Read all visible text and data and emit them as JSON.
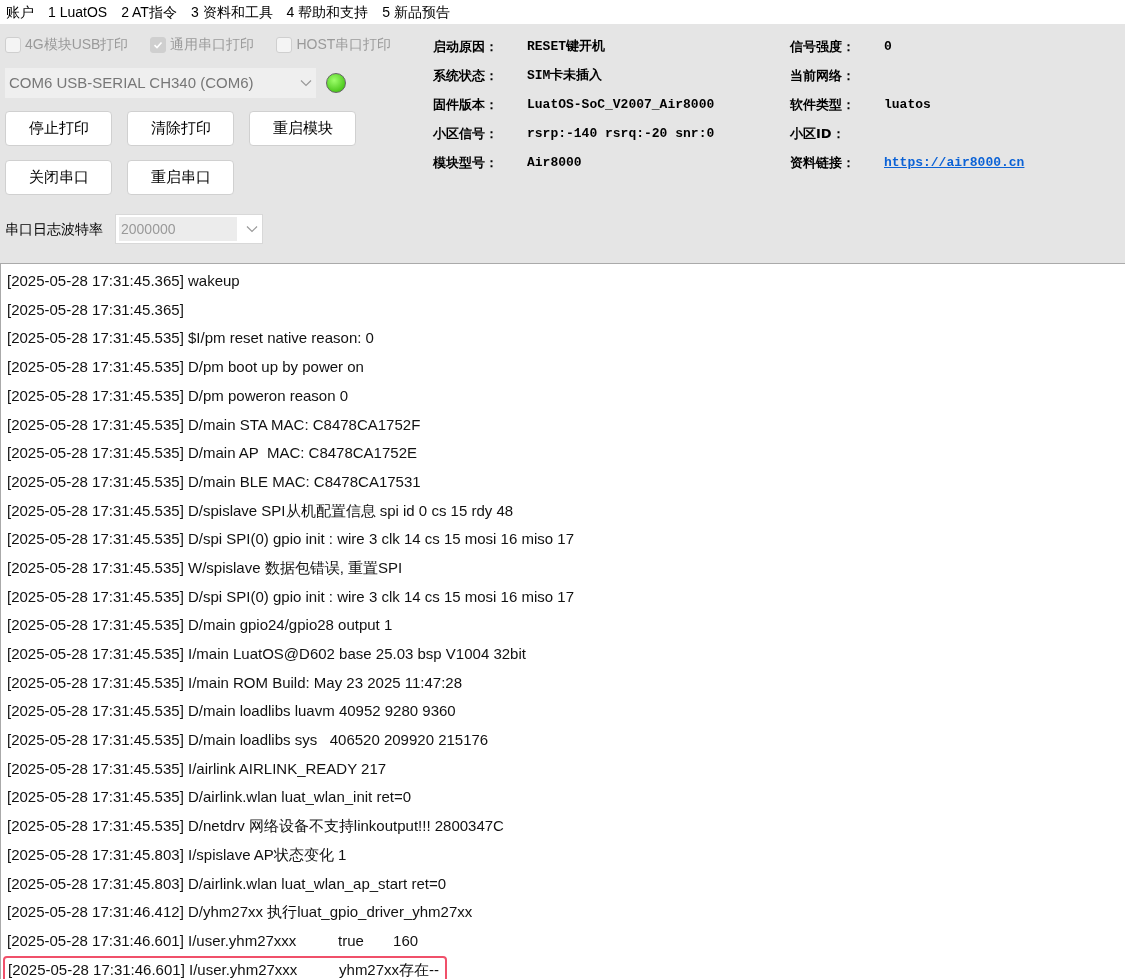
{
  "menu": [
    "账户",
    "1 LuatOS",
    "2 AT指令",
    "3 资料和工具",
    "4 帮助和支持",
    "5 新品预告"
  ],
  "print_options": [
    {
      "label": "4G模块USB打印",
      "checked": false,
      "disabled": true
    },
    {
      "label": "通用串口打印",
      "checked": true,
      "disabled": true
    },
    {
      "label": "HOST串口打印",
      "checked": false,
      "disabled": true
    }
  ],
  "port_select": {
    "value": "COM6 USB-SERIAL CH340 (COM6)",
    "connected": true,
    "disabled": true
  },
  "buttons": [
    [
      "停止打印",
      "清除打印",
      "重启模块"
    ],
    [
      "关闭串口",
      "重启串口"
    ]
  ],
  "baud": {
    "label": "串口日志波特率",
    "value": "2000000",
    "disabled": true
  },
  "info": [
    {
      "label": "启动原因：",
      "value": "RESET键开机"
    },
    {
      "label": "信号强度：",
      "value": "0"
    },
    {
      "label": "系统状态：",
      "value": "SIM卡未插入"
    },
    {
      "label": "当前网络："
    },
    {
      "label": "固件版本：",
      "value": "LuatOS-SoC_V2007_Air8000"
    },
    {
      "label": "软件类型：",
      "value": "luatos"
    },
    {
      "label": "小区信号：",
      "value": "rsrp:-140 rsrq:-20 snr:0"
    },
    {
      "label": "小区ID："
    },
    {
      "label": "模块型号：",
      "value": "Air8000"
    },
    {
      "label": "资料链接：",
      "value": "https://air8000.cn",
      "kind": "link"
    }
  ],
  "log": [
    {
      "text": "[2025-05-28 17:31:45.365] wakeup",
      "highlighted": false
    },
    {
      "text": "[2025-05-28 17:31:45.365]",
      "highlighted": false
    },
    {
      "text": "[2025-05-28 17:31:45.535] $I/pm reset native reason: 0",
      "highlighted": false
    },
    {
      "text": "[2025-05-28 17:31:45.535] D/pm boot up by power on",
      "highlighted": false
    },
    {
      "text": "[2025-05-28 17:31:45.535] D/pm poweron reason 0",
      "highlighted": false
    },
    {
      "text": "[2025-05-28 17:31:45.535] D/main STA MAC: C8478CA1752F",
      "highlighted": false
    },
    {
      "text": "[2025-05-28 17:31:45.535] D/main AP  MAC: C8478CA1752E",
      "highlighted": false
    },
    {
      "text": "[2025-05-28 17:31:45.535] D/main BLE MAC: C8478CA17531",
      "highlighted": false
    },
    {
      "text": "[2025-05-28 17:31:45.535] D/spislave SPI从机配置信息 spi id 0 cs 15 rdy 48",
      "highlighted": false
    },
    {
      "text": "[2025-05-28 17:31:45.535] D/spi SPI(0) gpio init : wire 3 clk 14 cs 15 mosi 16 miso 17",
      "highlighted": false
    },
    {
      "text": "[2025-05-28 17:31:45.535] W/spislave 数据包错误, 重置SPI",
      "highlighted": false
    },
    {
      "text": "[2025-05-28 17:31:45.535] D/spi SPI(0) gpio init : wire 3 clk 14 cs 15 mosi 16 miso 17",
      "highlighted": false
    },
    {
      "text": "[2025-05-28 17:31:45.535] D/main gpio24/gpio28 output 1",
      "highlighted": false
    },
    {
      "text": "[2025-05-28 17:31:45.535] I/main LuatOS@D602 base 25.03 bsp V1004 32bit",
      "highlighted": false
    },
    {
      "text": "[2025-05-28 17:31:45.535] I/main ROM Build: May 23 2025 11:47:28",
      "highlighted": false
    },
    {
      "text": "[2025-05-28 17:31:45.535] D/main loadlibs luavm 40952 9280 9360",
      "highlighted": false
    },
    {
      "text": "[2025-05-28 17:31:45.535] D/main loadlibs sys   406520 209920 215176",
      "highlighted": false
    },
    {
      "text": "[2025-05-28 17:31:45.535] I/airlink AIRLINK_READY 217",
      "highlighted": false
    },
    {
      "text": "[2025-05-28 17:31:45.535] D/airlink.wlan luat_wlan_init ret=0",
      "highlighted": false
    },
    {
      "text": "[2025-05-28 17:31:45.535] D/netdrv 网络设备不支持linkoutput!!! 2800347C",
      "highlighted": false
    },
    {
      "text": "[2025-05-28 17:31:45.803] I/spislave AP状态变化 1",
      "highlighted": false
    },
    {
      "text": "[2025-05-28 17:31:45.803] D/airlink.wlan luat_wlan_ap_start ret=0",
      "highlighted": false
    },
    {
      "text": "[2025-05-28 17:31:46.412] D/yhm27xx 执行luat_gpio_driver_yhm27xx",
      "highlighted": false
    },
    {
      "text": "[2025-05-28 17:31:46.601] I/user.yhm27xxx          true       160",
      "highlighted": false
    },
    {
      "text": "[2025-05-28 17:31:46.601] I/user.yhm27xxx          yhm27xx存在--",
      "highlighted": true
    }
  ]
}
